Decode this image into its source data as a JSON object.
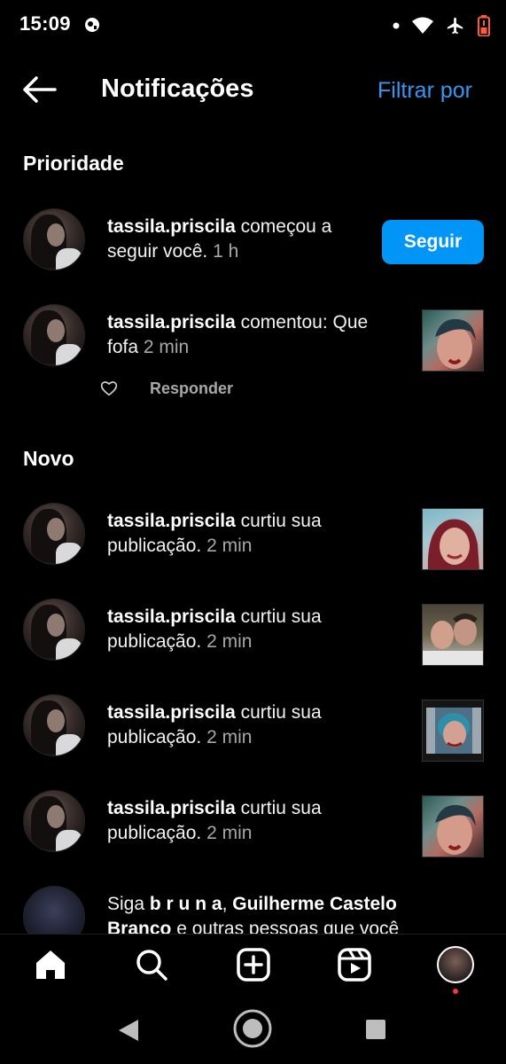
{
  "status_bar": {
    "time": "15:09"
  },
  "header": {
    "title": "Notificações",
    "filter_label": "Filtrar por"
  },
  "sections": {
    "priority": "Prioridade",
    "new": "Novo"
  },
  "priority": [
    {
      "user": "tassila.priscila",
      "action": "começou a seguir você.",
      "time": "1 h",
      "button": "Seguir"
    },
    {
      "user": "tassila.priscila",
      "action": "comentou: Que fofa",
      "time": "2 min",
      "reply_label": "Responder"
    }
  ],
  "new": [
    {
      "user": "tassila.priscila",
      "action": "curtiu sua publicação.",
      "time": "2 min"
    },
    {
      "user": "tassila.priscila",
      "action": "curtiu sua publicação.",
      "time": "2 min"
    },
    {
      "user": "tassila.priscila",
      "action": "curtiu sua publicação.",
      "time": "2 min"
    },
    {
      "user": "tassila.priscila",
      "action": "curtiu sua publicação.",
      "time": "2 min"
    }
  ],
  "suggestion": {
    "prefix": "Siga",
    "name1": "b r u n a",
    "sep": ",",
    "name2": "Guilherme Castelo Branco",
    "rest": "e outras pessoas que você conhece para ver"
  },
  "bottom_nav": [
    "home-icon",
    "search-icon",
    "new-post-icon",
    "reels-icon",
    "profile-avatar"
  ],
  "colors": {
    "accent": "#0095f6",
    "link": "#3797f0",
    "muted": "#a8a8a8",
    "badge": "#ff3040"
  }
}
